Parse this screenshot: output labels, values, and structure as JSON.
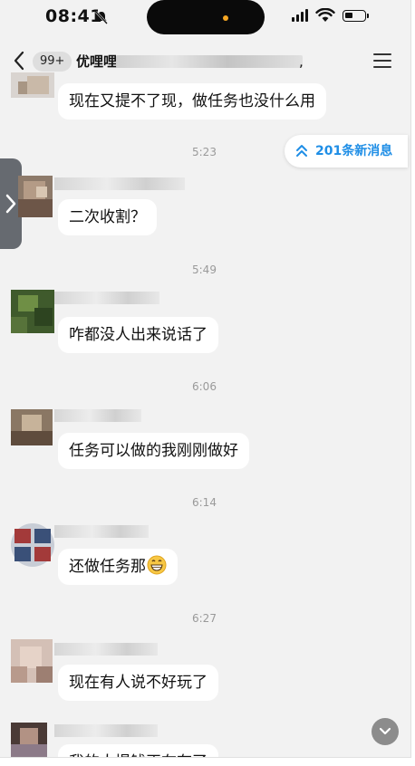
{
  "status_bar": {
    "time": "08:41"
  },
  "header": {
    "unread_badge": "99+",
    "title": "优哩哩",
    "title_suffix": ","
  },
  "new_messages": {
    "label": "201条新消息"
  },
  "messages": [
    {
      "text": "现在又提不了现，做任务也没什么用"
    },
    {
      "time": "5:23",
      "text": "二次收割？"
    },
    {
      "time": "5:49",
      "text": "咋都没人出来说话了"
    },
    {
      "time": "6:06",
      "text": "任务可以做的我刚刚做好"
    },
    {
      "time": "6:14",
      "text": "还做任务那"
    },
    {
      "time": "6:27",
      "text": "现在有人说不好玩了"
    },
    {
      "text": "我的人提钱正在有了"
    }
  ],
  "icons": {
    "back": "chevron-left-icon",
    "menu": "hamburger-menu-icon",
    "new_messages": "double-chevron-up-icon",
    "side_tab": "chevron-right-icon",
    "scroll_down": "chevron-down-icon",
    "emoji": "grinning-face-emoji"
  },
  "colors": {
    "accent": "#1f8ee6",
    "background": "#f2f2f2",
    "bubble": "#ffffff"
  }
}
